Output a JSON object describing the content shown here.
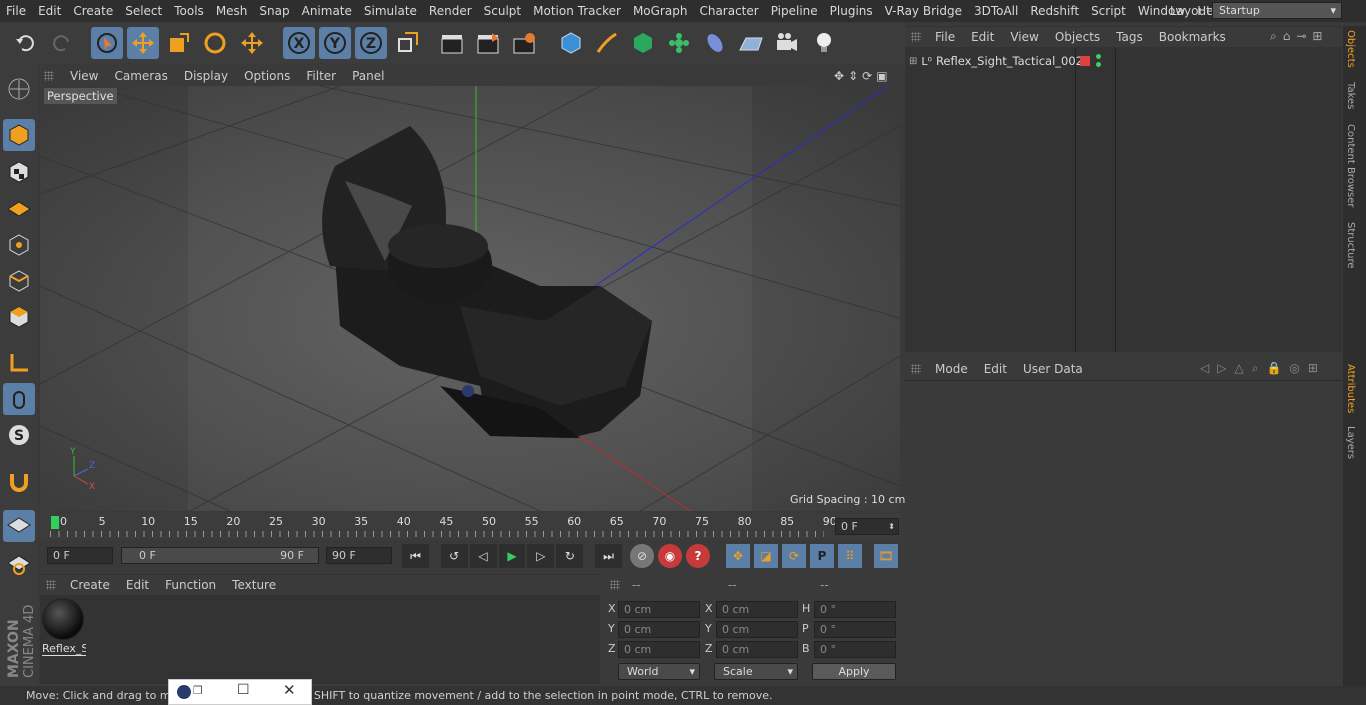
{
  "menu": [
    "File",
    "Edit",
    "Create",
    "Select",
    "Tools",
    "Mesh",
    "Snap",
    "Animate",
    "Simulate",
    "Render",
    "Sculpt",
    "Motion Tracker",
    "MoGraph",
    "Character",
    "Pipeline",
    "Plugins",
    "V-Ray Bridge",
    "3DToAll",
    "Redshift",
    "Script",
    "Window",
    "Help"
  ],
  "layout": {
    "label": "Layout:",
    "value": "Startup"
  },
  "viewport": {
    "menu": [
      "View",
      "Cameras",
      "Display",
      "Options",
      "Filter",
      "Panel"
    ],
    "label": "Perspective",
    "grid_spacing": "Grid Spacing : 10 cm"
  },
  "timeline": {
    "ticks": [
      "0",
      "5",
      "10",
      "15",
      "20",
      "25",
      "30",
      "35",
      "40",
      "45",
      "50",
      "55",
      "60",
      "65",
      "70",
      "75",
      "80",
      "85",
      "90"
    ],
    "current": "0 F",
    "start": "0 F",
    "range_start": "0 F",
    "range_end": "90 F",
    "end": "90 F"
  },
  "material": {
    "menu": [
      "Create",
      "Edit",
      "Function",
      "Texture"
    ],
    "item": "Reflex_S"
  },
  "coordinates": {
    "headers": [
      "--",
      "--",
      "--"
    ],
    "rows": [
      {
        "a": "X",
        "av": "0 cm",
        "b": "X",
        "bv": "0 cm",
        "c": "H",
        "cv": "0 °"
      },
      {
        "a": "Y",
        "av": "0 cm",
        "b": "Y",
        "bv": "0 cm",
        "c": "P",
        "cv": "0 °"
      },
      {
        "a": "Z",
        "av": "0 cm",
        "b": "Z",
        "bv": "0 cm",
        "c": "B",
        "cv": "0 °"
      }
    ],
    "world": "World",
    "scale": "Scale",
    "apply": "Apply"
  },
  "objects": {
    "menu": [
      "File",
      "Edit",
      "View",
      "Objects",
      "Tags",
      "Bookmarks"
    ],
    "item": "Reflex_Sight_Tactical_002"
  },
  "attributes": {
    "menu": [
      "Mode",
      "Edit",
      "User Data"
    ]
  },
  "sidetabs": [
    "Objects",
    "Takes",
    "Content Browser",
    "Structure",
    "Attributes",
    "Layers"
  ],
  "status": "Move: Click and drag to move elements. Hold down SHIFT to quantize movement / add to the selection in point mode, CTRL to remove.",
  "brand": "MAXON CINEMA 4D"
}
